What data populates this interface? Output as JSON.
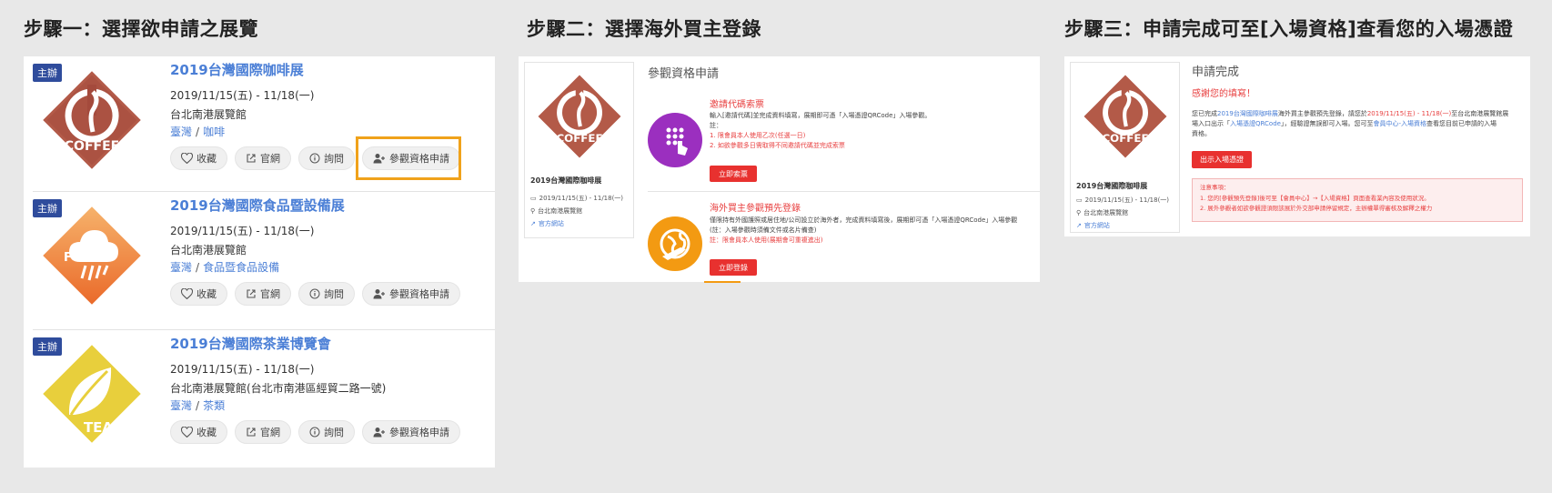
{
  "steps": {
    "step1": "步驟一：選擇欲申請之展覽",
    "step2": "步驟二：選擇海外買主登錄",
    "step3": "步驟三：申請完成可至[入場資格]查看您的入場憑證"
  },
  "expos": [
    {
      "badge": "主辦",
      "logo_text": "COFFEE",
      "title": "2019台灣國際咖啡展",
      "date": "2019/11/15(五) - 11/18(一)",
      "venue": "台北南港展覽館",
      "region": "臺灣",
      "category": "咖啡"
    },
    {
      "badge": "主辦",
      "logo_text": "FOOD",
      "title": "2019台灣國際食品暨設備展",
      "date": "2019/11/15(五) - 11/18(一)",
      "venue": "台北南港展覽館",
      "region": "臺灣",
      "category": "食品暨食品設備"
    },
    {
      "badge": "主辦",
      "logo_text": "TEA",
      "title": "2019台灣國際茶業博覽會",
      "date": "2019/11/15(五) - 11/18(一)",
      "venue": "台北南港展覽館(台北市南港區經貿二路一號)",
      "region": "臺灣",
      "category": "茶類"
    }
  ],
  "buttons": {
    "favorite": "收藏",
    "website": "官網",
    "inquiry": "詢問",
    "apply": "參觀資格申請"
  },
  "side_card": {
    "logo_text": "COFFEE",
    "name": "2019台灣國際咖啡展",
    "date": "2019/11/15(五) - 11/18(一)",
    "venue": "台北南港展覽館",
    "link": "官方網站"
  },
  "step2": {
    "heading": "參觀資格申請",
    "option1": {
      "title": "邀請代碼索票",
      "line1": "輸入[邀請代碼]並完成資料填寫，展期即可憑「入場憑證QRCode」入場參觀。",
      "line2": "註：",
      "line3": "1. 限會員本人使用乙次(任選一日)",
      "line4": "2. 如欲參觀多日需取得不同邀請代碼並完成索票",
      "button": "立即索票"
    },
    "option2": {
      "title": "海外買主參觀預先登錄",
      "line1": "僅限持有外國護照或居住地/公司設立於海外者，完成資料填寫後，展期即可憑「入場憑證QRCode」入場參觀",
      "line2": "(註：入場參觀時須備文件或名片備查)",
      "line3": "註：限會員本人使用(展期會可重複進出)",
      "button": "立即登錄"
    }
  },
  "step3": {
    "heading": "申請完成",
    "thanks": "感謝您的填寫！",
    "msg1_a": "您已完成",
    "msg1_b": "2019台灣國際咖啡展",
    "msg1_c": "海外買主參觀預先登錄，請您於",
    "msg1_d": "2019/11/15(五) - 11/18(一)",
    "msg1_e": "至台北南港展覽館展",
    "msg2_a": "場入口出示「",
    "msg2_b": "入場憑證QRCode",
    "msg2_c": "」，經驗證無誤即可入場。您可至",
    "msg2_d": "會員中心-入場資格",
    "msg2_e": "查看您目前已申請的入場",
    "msg3": "資格。",
    "button": "出示入場憑證",
    "note_title": "注意事項：",
    "note1": "1. 您的[參觀預先登錄]後可至【會員中心】→【入場資格】頁面查看業內容及使用狀況。",
    "note2": "2. 展外參觀者如欲參觀證須限該展於外交部申請停留規定，主辦權單得審核及解釋之權力"
  }
}
